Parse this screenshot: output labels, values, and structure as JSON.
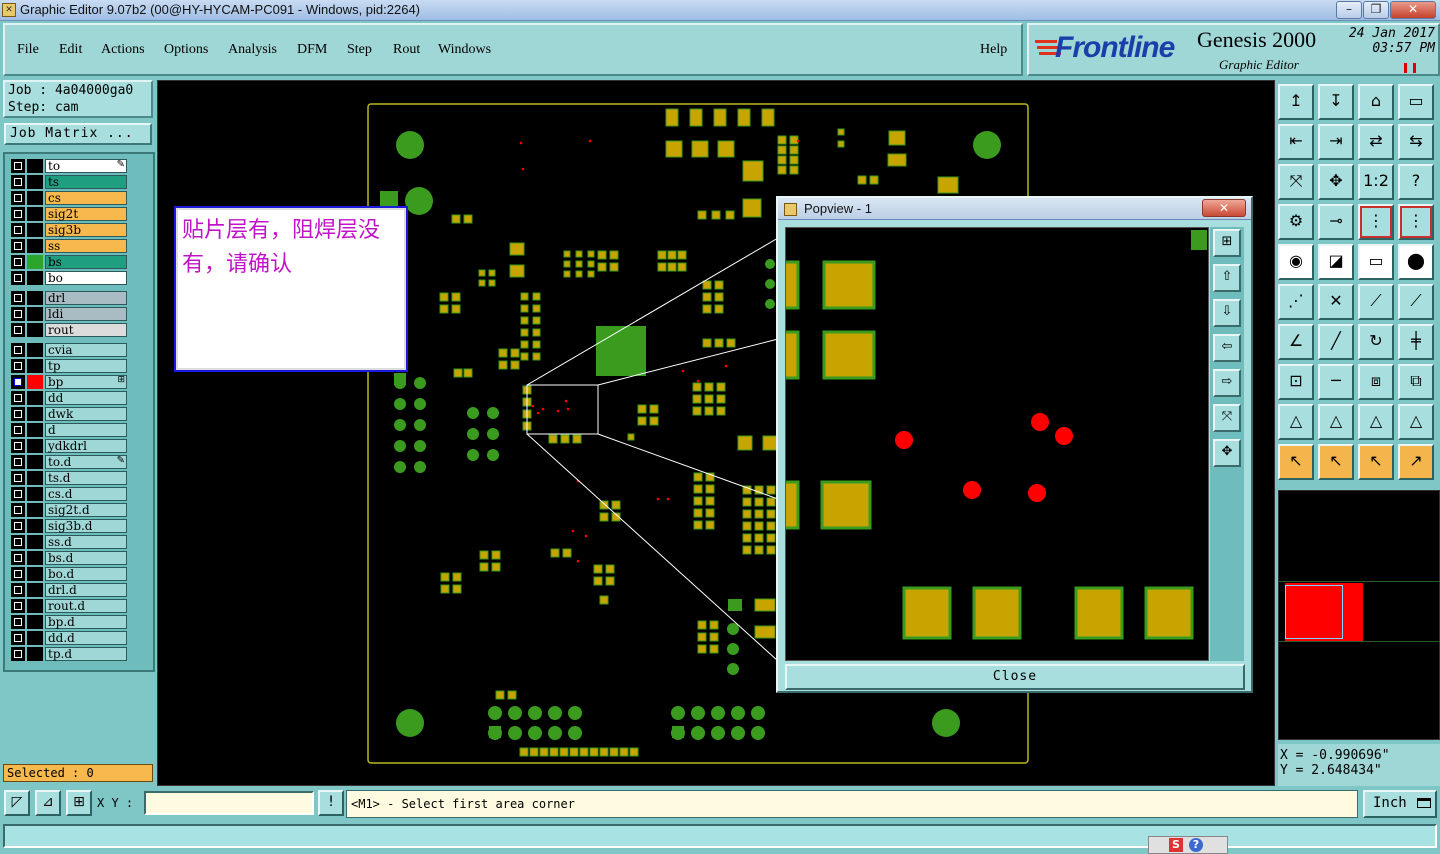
{
  "window": {
    "title": "Graphic Editor 9.07b2 (00@HY-HYCAM-PC091 - Windows, pid:2264)"
  },
  "menu": {
    "items": [
      "File",
      "Edit",
      "Actions",
      "Options",
      "Analysis",
      "DFM",
      "Step",
      "Rout",
      "Windows"
    ],
    "help": "Help"
  },
  "brand": {
    "logo_main": "Frontline",
    "product": "Genesis 2000",
    "subtitle": "Graphic Editor",
    "date": "24 Jan 2017",
    "time": "03:57 PM"
  },
  "job": {
    "job_label": "Job : 4a04000ga0",
    "step_label": "Step: cam",
    "matrix_button": "Job Matrix ..."
  },
  "layers": [
    {
      "name": "to",
      "color": "#ffffff",
      "extra": "pen"
    },
    {
      "name": "ts",
      "color": "#1f9e80"
    },
    {
      "name": "cs",
      "color": "#f7b94e"
    },
    {
      "name": "sig2t",
      "color": "#f7b94e"
    },
    {
      "name": "sig3b",
      "color": "#f7b94e"
    },
    {
      "name": "ss",
      "color": "#f7b94e"
    },
    {
      "name": "bs",
      "color": "#1f9e80"
    },
    {
      "name": "bo",
      "color": "#ffffff"
    },
    {
      "name": "drl",
      "color": "#a9bcc4"
    },
    {
      "name": "ldi",
      "color": "#a9bcc4"
    },
    {
      "name": "rout",
      "color": "#dcdcdc"
    },
    {
      "name": "cvia",
      "color": "#9fd6d6"
    },
    {
      "name": "tp",
      "color": "#9fd6d6"
    },
    {
      "name": "bp",
      "color": "#9fd6d6",
      "active": true
    },
    {
      "name": "dd",
      "color": "#9fd6d6"
    },
    {
      "name": "dwk",
      "color": "#9fd6d6"
    },
    {
      "name": "d",
      "color": "#9fd6d6"
    },
    {
      "name": "ydkdrl",
      "color": "#9fd6d6"
    },
    {
      "name": "to.d",
      "color": "#9fd6d6",
      "extra": "pen"
    },
    {
      "name": "ts.d",
      "color": "#9fd6d6"
    },
    {
      "name": "cs.d",
      "color": "#9fd6d6"
    },
    {
      "name": "sig2t.d",
      "color": "#9fd6d6"
    },
    {
      "name": "sig3b.d",
      "color": "#9fd6d6"
    },
    {
      "name": "ss.d",
      "color": "#9fd6d6"
    },
    {
      "name": "bs.d",
      "color": "#9fd6d6"
    },
    {
      "name": "bo.d",
      "color": "#9fd6d6"
    },
    {
      "name": "drl.d",
      "color": "#9fd6d6"
    },
    {
      "name": "rout.d",
      "color": "#9fd6d6"
    },
    {
      "name": "bp.d",
      "color": "#9fd6d6"
    },
    {
      "name": "dd.d",
      "color": "#9fd6d6"
    },
    {
      "name": "tp.d",
      "color": "#9fd6d6"
    }
  ],
  "selected_label": "Selected : 0",
  "annotation": {
    "text": "贴片层有，阻焊层没有，请确认"
  },
  "popview": {
    "title": "Popview - 1",
    "close_label": "Close"
  },
  "coords": {
    "x": "X = -0.990696\"",
    "y": "Y = 2.648434\""
  },
  "status": {
    "xy_label": "X Y :",
    "xy_value": "",
    "message": "<M1> - Select first area corner",
    "unit": "Inch"
  },
  "colors": {
    "pad": "#c8a400",
    "mask": "#3a9b1f",
    "highlight": "#ff0000",
    "background": "#000000",
    "panel": "#9fd6d6"
  }
}
